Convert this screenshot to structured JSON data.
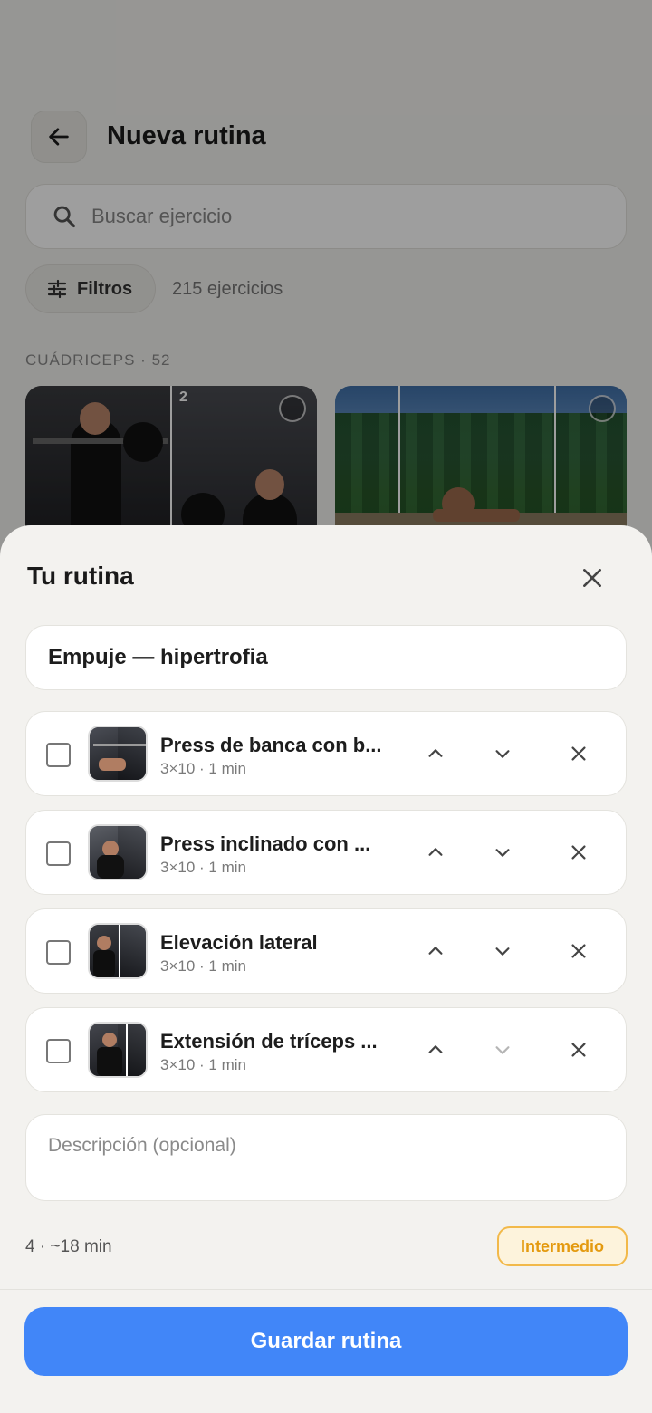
{
  "header": {
    "title": "Nueva rutina"
  },
  "search": {
    "placeholder": "Buscar ejercicio"
  },
  "filters": {
    "label": "Filtros",
    "count_text": "215 ejercicios"
  },
  "section": {
    "label": "CUÁDRICEPS · 52",
    "first_card_number": "2"
  },
  "sheet": {
    "title": "Tu rutina",
    "routine_name": "Empuje — hipertrofia",
    "exercises": [
      {
        "name": "Press de banca con b...",
        "meta": "3×10 · 1 min"
      },
      {
        "name": "Press inclinado con ...",
        "meta": "3×10 · 1 min"
      },
      {
        "name": "Elevación lateral",
        "meta": "3×10 · 1 min"
      },
      {
        "name": "Extensión de tríceps ...",
        "meta": "3×10 · 1 min"
      }
    ],
    "description_placeholder": "Descripción (opcional)",
    "summary": "4 · ~18 min",
    "level": "Intermedio",
    "save_label": "Guardar rutina"
  },
  "colors": {
    "primary": "#4186f8",
    "level_accent": "#e49a10"
  }
}
